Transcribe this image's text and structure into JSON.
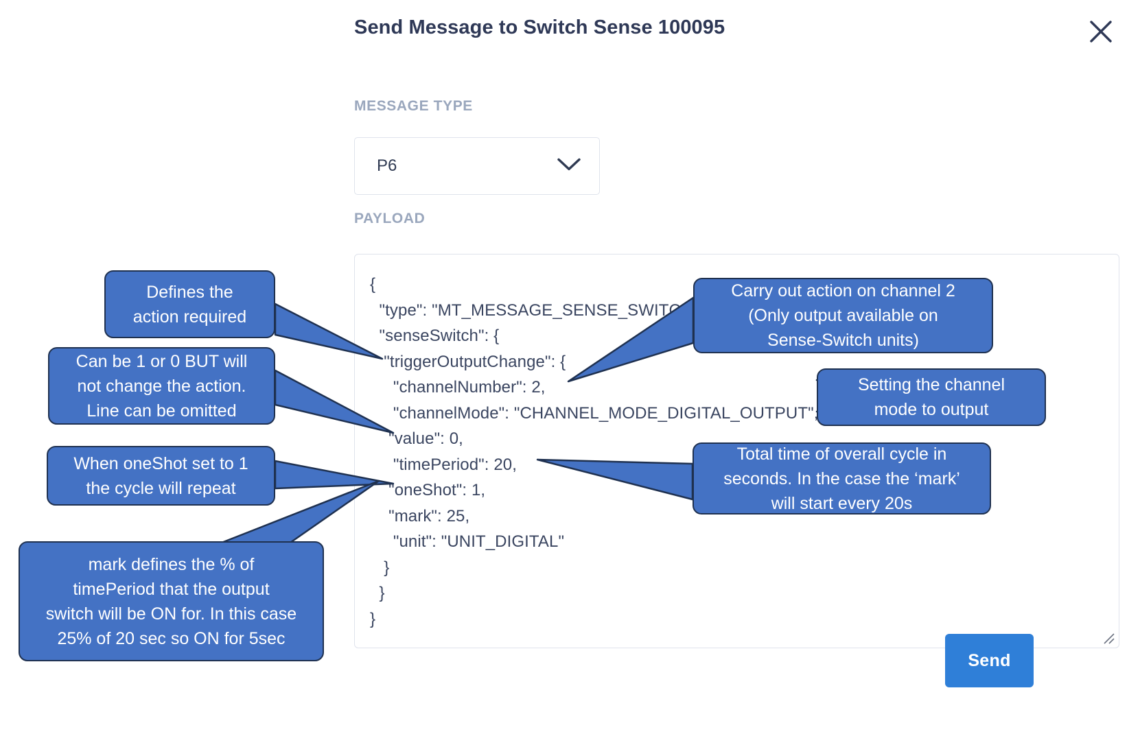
{
  "dialog": {
    "title": "Send Message to Switch Sense 100095",
    "close_icon": "close-icon"
  },
  "form": {
    "message_type": {
      "label": "MESSAGE TYPE",
      "value": "P6",
      "chevron_icon": "chevron-down-icon"
    },
    "payload": {
      "label": "PAYLOAD",
      "value": "{\n  \"type\": \"MT_MESSAGE_SENSE_SWITCH\",\n  \"senseSwitch\": {\n   \"triggerOutputChange\": {\n     \"channelNumber\": 2,\n     \"channelMode\": \"CHANNEL_MODE_DIGITAL_OUTPUT\",\n    \"value\": 0,\n     \"timePeriod\": 20,\n    \"oneShot\": 1,\n    \"mark\": 25,\n     \"unit\": \"UNIT_DIGITAL\"\n   }\n  }\n}",
      "resize_handle_icon": "resize-handle-icon"
    }
  },
  "actions": {
    "send_label": "Send"
  },
  "annotations": [
    {
      "id": "defines-action",
      "text": "Defines the\naction required"
    },
    {
      "id": "channel-two",
      "text": "Carry out action on channel 2\n(Only output available on\nSense-Switch units)"
    },
    {
      "id": "value-note",
      "text": "Can be 1 or 0 BUT will\nnot change the action.\nLine can be omitted"
    },
    {
      "id": "channel-mode",
      "text": "Setting the channel\nmode to output"
    },
    {
      "id": "one-shot",
      "text": "When oneShot set to 1\nthe cycle will repeat"
    },
    {
      "id": "time-period",
      "text": "Total time of overall cycle in\nseconds. In the case the ‘mark’\nwill start every 20s"
    },
    {
      "id": "mark-note",
      "text": "mark defines the % of\ntimePeriod that the output\nswitch will be ON for. In this case\n25% of 20 sec so ON for 5sec"
    }
  ],
  "colors": {
    "callout_fill": "#4472c4",
    "callout_border": "#1f3150",
    "send_button": "#2f7fd8",
    "title_text": "#2e3856",
    "label_text": "#9aa7bd"
  }
}
